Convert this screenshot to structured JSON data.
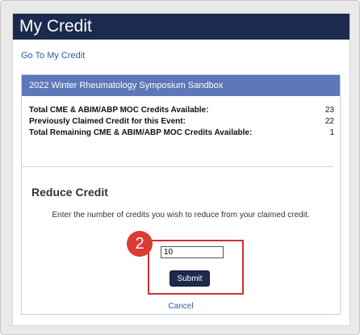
{
  "header": {
    "title": "My Credit"
  },
  "nav": {
    "goto_label": "Go To My Credit"
  },
  "event": {
    "name": "2022 Winter Rheumatology Symposium Sandbox"
  },
  "stats": [
    {
      "label": "Total CME & ABIM/ABP MOC Credits Available:",
      "value": "23"
    },
    {
      "label": "Previously Claimed Credit for this Event:",
      "value": "22"
    },
    {
      "label": "Total Remaining CME & ABIM/ABP MOC Credits Available:",
      "value": "1"
    }
  ],
  "reduce": {
    "title": "Reduce Credit",
    "instructions": "Enter the number of credits you wish to reduce from your claimed credit.",
    "input_value": "10",
    "step_number": "2",
    "submit_label": "Submit",
    "cancel_label": "Cancel"
  },
  "colors": {
    "title_bar": "#1c2a4d",
    "card_header": "#5d78b8",
    "highlight": "#d0302f",
    "link": "#2f59a7"
  }
}
